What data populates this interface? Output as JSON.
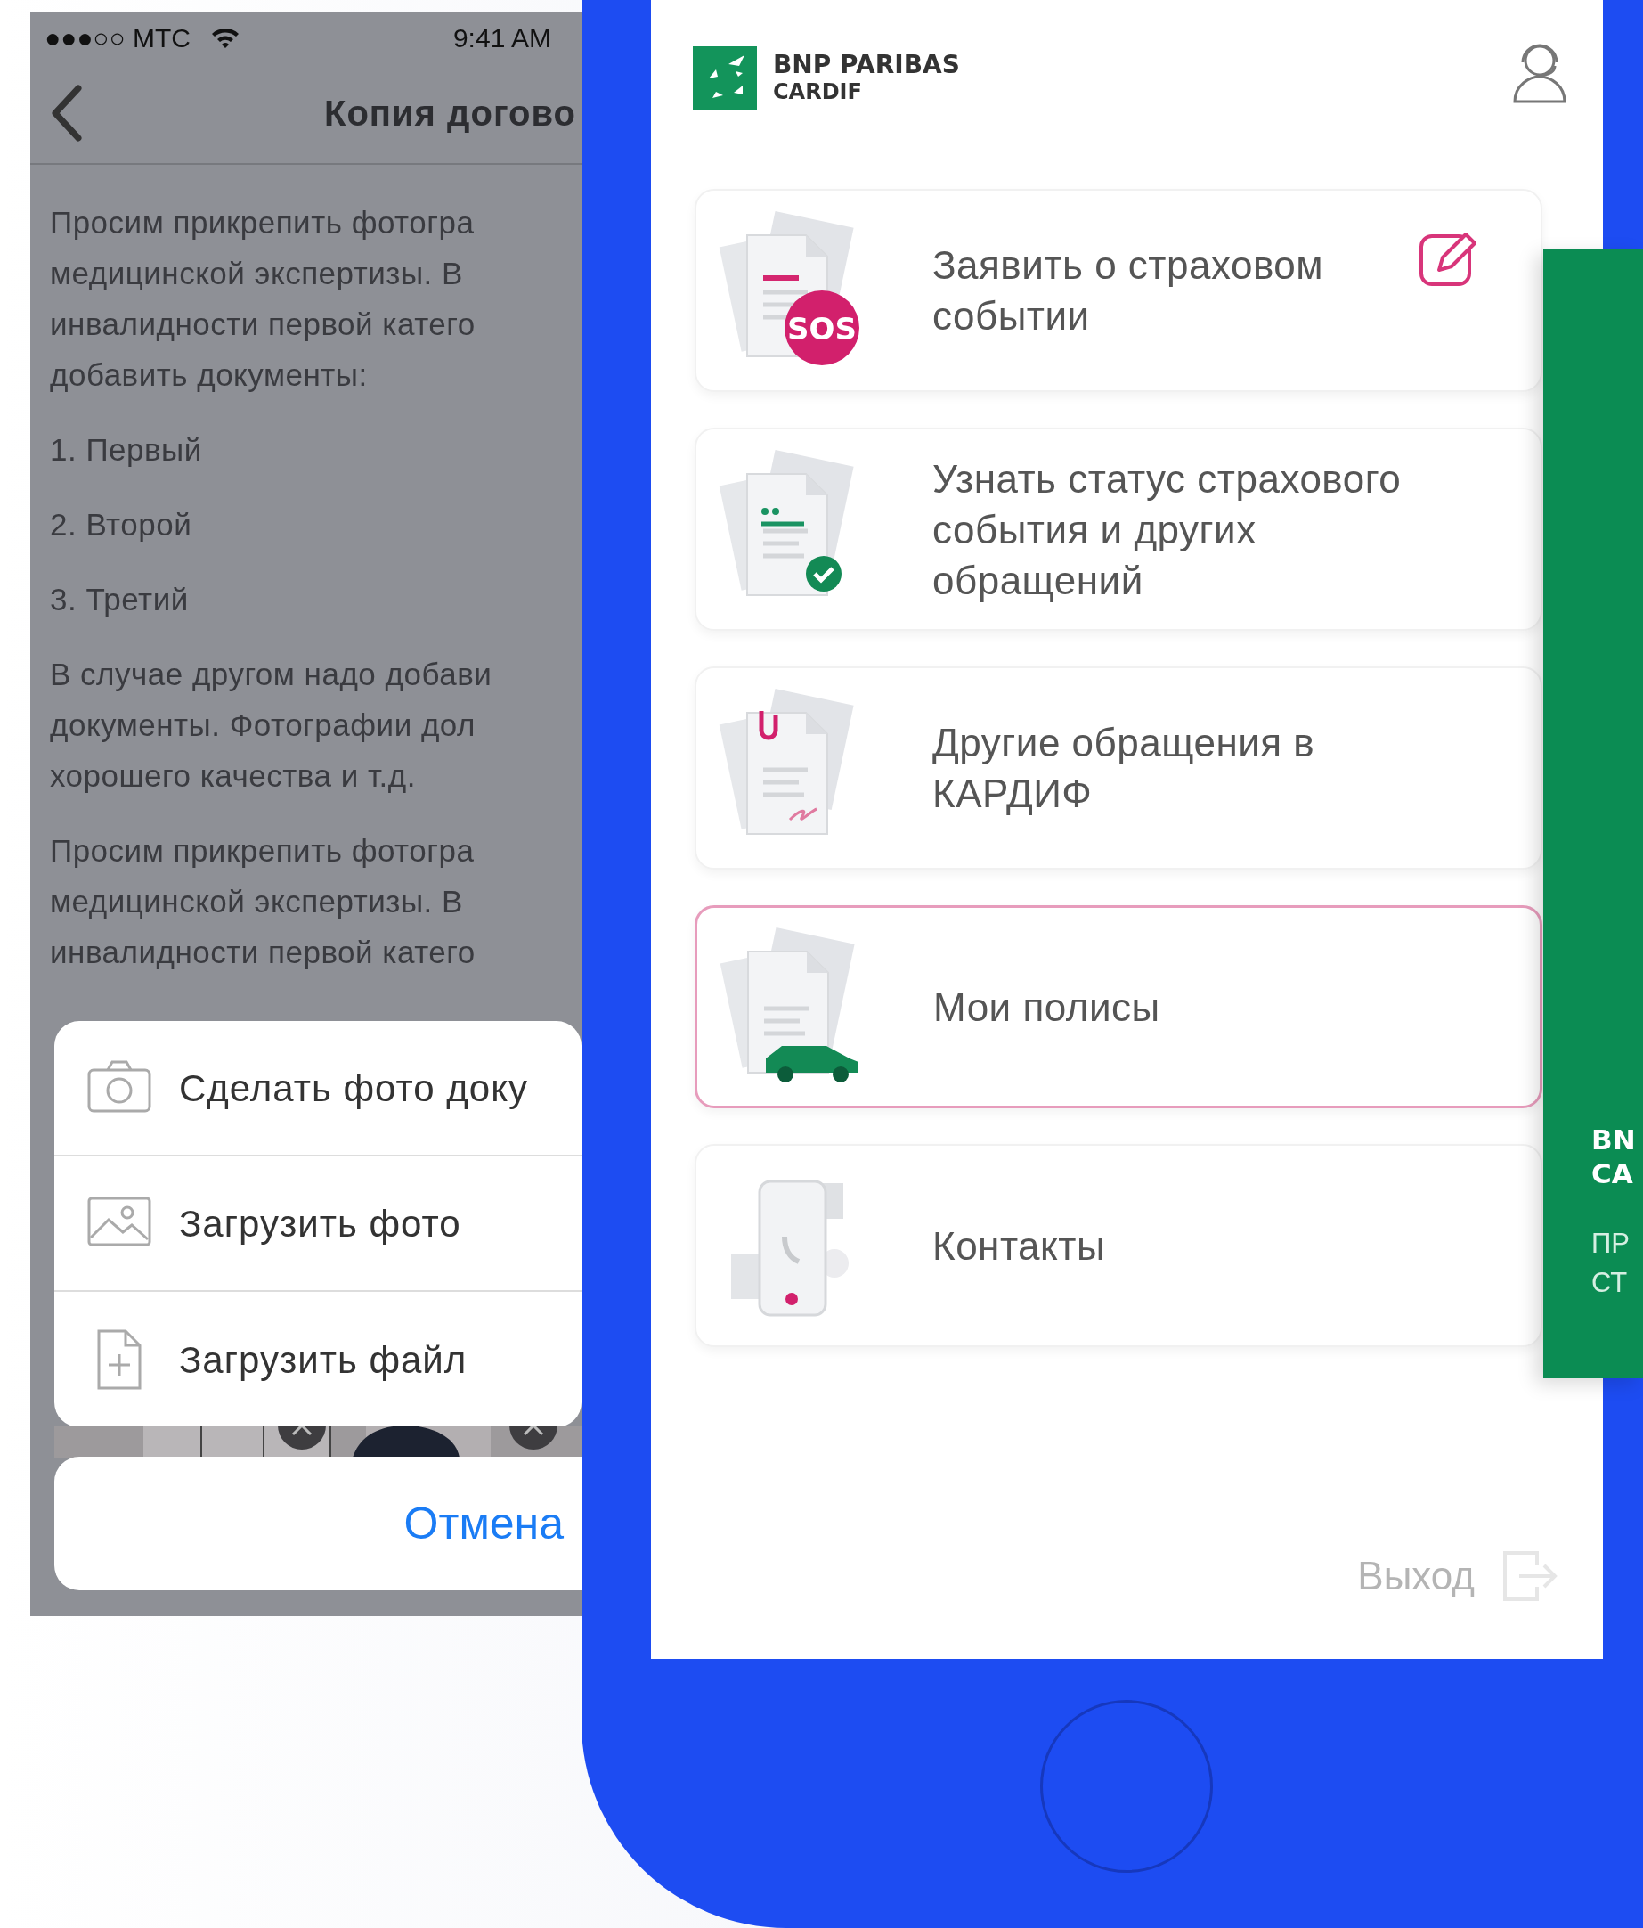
{
  "left_screen": {
    "status_bar": {
      "carrier": "●●●○○ MTC",
      "time": "9:41 AM"
    },
    "nav_bar": {
      "title": "Копия догово"
    },
    "paragraphs": [
      {
        "lines": [
          "Просим прикрепить фотогра",
          "медицинской экспертизы. В",
          "инвалидности первой катего",
          "добавить документы:"
        ]
      },
      {
        "lines": [
          "1. Первый"
        ]
      },
      {
        "lines": [
          "2. Второй"
        ]
      },
      {
        "lines": [
          "3. Третий"
        ]
      },
      {
        "lines": [
          "В случае другом надо добави",
          "документы. Фотографии дол",
          "хорошего качества и т.д."
        ]
      },
      {
        "lines": [
          "Просим прикрепить фотогра",
          "медицинской экспертизы. В",
          "инвалидности первой катего"
        ]
      }
    ],
    "action_sheet": {
      "items": [
        {
          "kind": "camera",
          "label": "Сделать фото доку"
        },
        {
          "kind": "image",
          "label": "Загрузить фото"
        },
        {
          "kind": "file",
          "label": "Загрузить файл"
        }
      ],
      "cancel": "Отмена"
    }
  },
  "right_screen": {
    "logo": {
      "line_1": "BNP PARIBAS",
      "line_2": "CARDIF"
    },
    "menu": [
      {
        "kind": "sos",
        "label": "Заявить о страховом событии",
        "badge": "SOS",
        "editable": true,
        "selected": false
      },
      {
        "kind": "check",
        "label": "Узнать статус страхового события и других обращений",
        "editable": false,
        "selected": false
      },
      {
        "kind": "clip",
        "label": "Другие обращения в КАРДИФ",
        "editable": false,
        "selected": false
      },
      {
        "kind": "car",
        "label": "Мои полисы",
        "editable": false,
        "selected": true
      },
      {
        "kind": "contacts",
        "label": "Контакты",
        "editable": false,
        "selected": false
      }
    ],
    "logout": "Выход"
  },
  "side_banner": {
    "title_lines": [
      "BN",
      "CA"
    ],
    "subtitle_lines": [
      "ПР",
      "СТ"
    ]
  }
}
